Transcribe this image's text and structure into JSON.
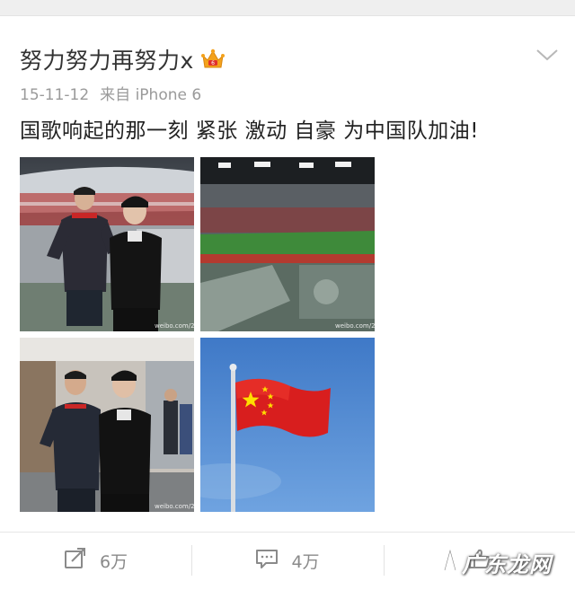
{
  "post": {
    "username": "努力努力再努力x",
    "date": "15-11-12",
    "source": "来自 iPhone 6",
    "text": "国歌响起的那一刻 紧张 激动 自豪 为中国队加油!"
  },
  "icons": {
    "badge": "crown-badge-icon",
    "menu": "chevron-down-icon",
    "repost": "repost-icon",
    "comment": "comment-icon",
    "like": "thumbs-up-icon"
  },
  "photos": [
    {
      "name": "photo-1",
      "watermark": "weibo.com/270"
    },
    {
      "name": "photo-2",
      "watermark": "weibo.com/270"
    },
    {
      "name": "photo-3",
      "watermark": "weibo.com/270"
    },
    {
      "name": "photo-4"
    }
  ],
  "actions": {
    "repost_count": "6万",
    "comment_count": "4万"
  },
  "watermark": {
    "text": "广东龙网"
  },
  "colors": {
    "flag_red": "#d81e1e",
    "flag_star": "#ffde00",
    "sky": "#4a86d4",
    "pitch_green": "#3e8a3a"
  }
}
